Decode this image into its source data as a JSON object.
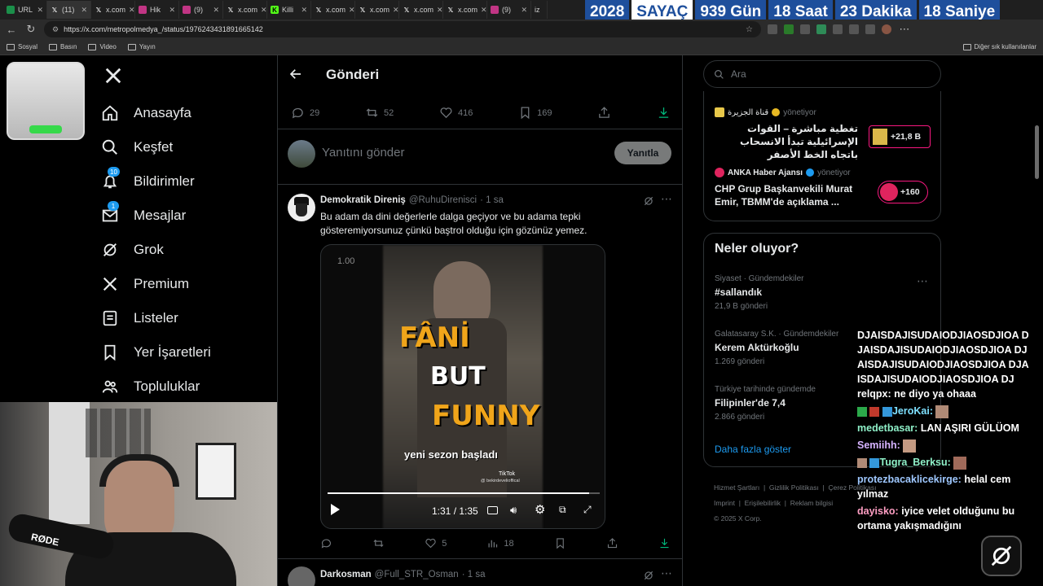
{
  "browser": {
    "tabs": [
      {
        "label": "URL",
        "color": "#1b8f4a"
      },
      {
        "label": "(11)",
        "color": "#000000"
      },
      {
        "label": "x.com",
        "color": "#000000"
      },
      {
        "label": "Hik",
        "color": "#c13584"
      },
      {
        "label": "(9)",
        "color": "#c13584"
      },
      {
        "label": "x.com",
        "color": "#000000"
      },
      {
        "label": "Killi",
        "color": "#53fc18"
      },
      {
        "label": "x.com",
        "color": "#000000"
      },
      {
        "label": "x.com",
        "color": "#000000"
      },
      {
        "label": "x.com",
        "color": "#000000"
      },
      {
        "label": "x.com",
        "color": "#000000"
      },
      {
        "label": "(9)",
        "color": "#c13584"
      },
      {
        "label": "iz",
        "color": "#000000"
      }
    ],
    "url": "https://x.com/metropolmedya_/status/1976243431891665142",
    "bookmarks": [
      "Sosyal",
      "Basın",
      "Video",
      "Yayın"
    ],
    "other_bookmarks": "Diğer sık kullanılanlar"
  },
  "countdown": {
    "year": "2028",
    "label": "SAYAÇ",
    "days": "939 Gün",
    "hours": "18 Saat",
    "minutes": "23 Dakika",
    "seconds": "18 Saniye"
  },
  "nav": {
    "items": [
      {
        "label": "Anasayfa"
      },
      {
        "label": "Keşfet"
      },
      {
        "label": "Bildirimler",
        "badge": "10"
      },
      {
        "label": "Mesajlar",
        "badge": "1"
      },
      {
        "label": "Grok"
      },
      {
        "label": "Premium"
      },
      {
        "label": "Listeler"
      },
      {
        "label": "Yer İşaretleri"
      },
      {
        "label": "Topluluklar"
      }
    ]
  },
  "post_header": {
    "title": "Gönderi"
  },
  "main_actions": {
    "replies": "29",
    "reposts": "52",
    "likes": "416",
    "bookmarks": "169"
  },
  "reply_box": {
    "placeholder": "Yanıtını gönder",
    "button": "Yanıtla"
  },
  "reply1": {
    "name": "Demokratik Direniş",
    "handle": "@RuhuDirenisci",
    "time": "· 1 sa",
    "text": "Bu adam da dini değerlerle dalga geçiyor ve bu adama tepki gösteremiyorsunuz çünkü baştrol olduğu için gözünüz yemez.",
    "video": {
      "speed": "1.00",
      "line1": "FÂNİ",
      "line2": "BUT",
      "line3": "FUNNY",
      "caption": "yeni sezon başladı",
      "watermark": "TikTok",
      "watermark_user": "@ bekirdevelioffical",
      "time": "1:31 / 1:35",
      "progress": 0.96
    },
    "actions": {
      "likes": "5",
      "views": "18"
    }
  },
  "reply2": {
    "name": "Darkosman",
    "handle": "@Full_STR_Osman",
    "time": "· 1 sa"
  },
  "search": {
    "placeholder": "Ara"
  },
  "news": [
    {
      "source": "قناة الجزيرة",
      "managed": "yönetiyor",
      "text": "تغطية مباشرة – القوات الإسرائيلية تبدأ الانسحاب باتجاه الخط الأصفر",
      "count": "+21,8 B"
    },
    {
      "source": "ANKA Haber Ajansı",
      "managed": "yönetiyor",
      "text": "CHP Grup Başkanvekili Murat Emir, TBMM'de açıklama ...",
      "count": "+160"
    }
  ],
  "trends": {
    "title": "Neler oluyor?",
    "items": [
      {
        "context": "Siyaset · Gündemdekiler",
        "name": "#sallandık",
        "count": "21,9 B gönderi"
      },
      {
        "context": "Galatasaray S.K. · Gündemdekiler",
        "name": "Kerem Aktürkoğlu",
        "count": "1.269 gönderi"
      },
      {
        "context": "Türkiye tarihinde gündemde",
        "name": "Filipinler'de 7,4",
        "count": "2.866 gönderi"
      }
    ],
    "more": "Daha fazla göster"
  },
  "footer": {
    "links": [
      "Hizmet Şartları",
      "Gizlilik Politikası",
      "Çerez Politikası",
      "Imprint",
      "Erişilebilirlik",
      "Reklam bilgisi"
    ],
    "copyright": "© 2025 X Corp."
  },
  "chat": [
    {
      "user": "",
      "msg": "DJAISDAJISUDAIODJIAOSDJIOA DJAISDAJISUDAIODJIAOSDJIOA DJAISDAJISUDAIODJIAOSDJIOA DJAISDAJISUDAIODJIAOSDJIOA DJ",
      "color": "#ffffff"
    },
    {
      "user": "relqpx:",
      "msg": "ne diyo ya ohaaa",
      "color": "#ffffff"
    },
    {
      "user": "JeroKai:",
      "msg": "",
      "color": "#7ee0ff"
    },
    {
      "user": "medetbasar:",
      "msg": "LAN AŞIRI GÜLÜOM",
      "color": "#8ff0c8"
    },
    {
      "user": "Semiihh:",
      "msg": "",
      "color": "#d6b3ff"
    },
    {
      "user": "Tugra_Berksu:",
      "msg": "",
      "color": "#8ff0c8"
    },
    {
      "user": "protezbacaklicekirge:",
      "msg": "helal cem yılmaz",
      "color": "#9fc8ff"
    },
    {
      "user": "dayisko:",
      "msg": "iyice velet olduğunu bu ortama yakışmadığını",
      "color": "#ff9ec3"
    }
  ],
  "webcam": {
    "mic_brand": "RØDE"
  }
}
